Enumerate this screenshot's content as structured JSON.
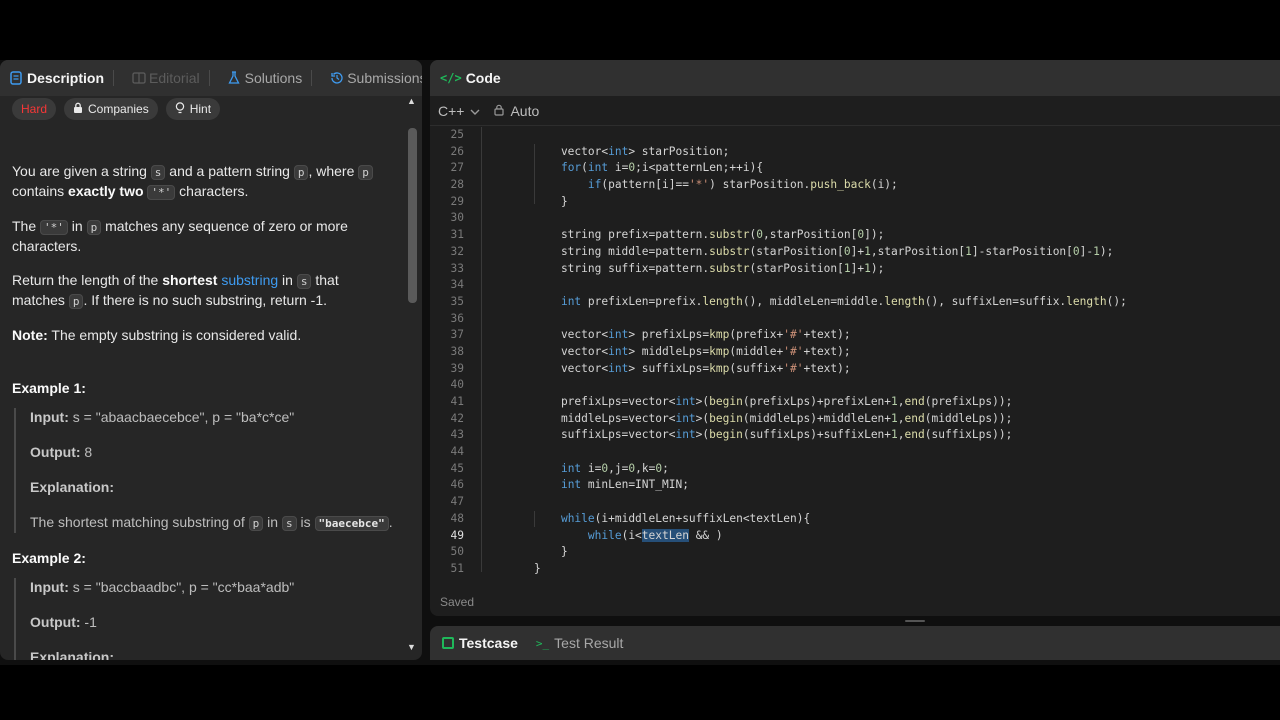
{
  "left_tabs": {
    "description": "Description",
    "editorial": "Editorial",
    "solutions": "Solutions",
    "submissions": "Submissions"
  },
  "chips": {
    "difficulty": "Hard",
    "companies": "Companies",
    "hint": "Hint"
  },
  "problem": {
    "p1_a": "You are given a string ",
    "p1_s": "s",
    "p1_b": " and a pattern string ",
    "p1_p": "p",
    "p1_c": ", where ",
    "p1_p2": "p",
    "p1_d": " contains ",
    "p1_bold": "exactly two",
    "p1_star": "'*'",
    "p1_e": " characters.",
    "p2_a": "The ",
    "p2_star": "'*'",
    "p2_b": " in ",
    "p2_p": "p",
    "p2_c": " matches any sequence of zero or more characters.",
    "p3_a": "Return the length of the ",
    "p3_bold": "shortest",
    "p3_link": "substring",
    "p3_b": " in ",
    "p3_s": "s",
    "p3_c": " that matches ",
    "p3_p": "p",
    "p3_d": ". If there is no such substring, return -1.",
    "note_label": "Note:",
    "note_text": " The empty substring is considered valid."
  },
  "examples": [
    {
      "title": "Example 1:",
      "input_label": "Input:",
      "input_value": " s = \"abaacbaecebce\", p = \"ba*c*ce\"",
      "output_label": "Output:",
      "output_value": " 8",
      "explanation_label": "Explanation:",
      "explanation_a": "The shortest matching substring of ",
      "explanation_p": "p",
      "explanation_b": " in ",
      "explanation_s": "s",
      "explanation_c": " is ",
      "explanation_code": "\"baecebce\"",
      "explanation_d": "."
    },
    {
      "title": "Example 2:",
      "input_label": "Input:",
      "input_value": " s = \"baccbaadbc\", p = \"cc*baa*adb\"",
      "output_label": "Output:",
      "output_value": " -1",
      "explanation_label": "Explanation:"
    }
  ],
  "code_panel": {
    "title": "Code",
    "language": "C++",
    "mode": "Auto",
    "status": "Saved"
  },
  "code_lines": [
    {
      "n": "25",
      "html": ""
    },
    {
      "n": "26",
      "html": "    vector&lt;<span class=\"kw\">int</span>&gt; starPosition;"
    },
    {
      "n": "27",
      "html": "    <span class=\"kw\">for</span>(<span class=\"kw\">int</span> i=<span class=\"nu\">0</span>;i&lt;patternLen;++i){"
    },
    {
      "n": "28",
      "html": "        <span class=\"kw\">if</span>(pattern[i]==<span class=\"st\">'*'</span>) starPosition.<span class=\"fn\">push_back</span>(i);"
    },
    {
      "n": "29",
      "html": "    }"
    },
    {
      "n": "30",
      "html": ""
    },
    {
      "n": "31",
      "html": "    string prefix=pattern.<span class=\"fn\">substr</span>(<span class=\"nu\">0</span>,starPosition[<span class=\"nu\">0</span>]);"
    },
    {
      "n": "32",
      "html": "    string middle=pattern.<span class=\"fn\">substr</span>(starPosition[<span class=\"nu\">0</span>]+<span class=\"nu\">1</span>,starPosition[<span class=\"nu\">1</span>]-starPosition[<span class=\"nu\">0</span>]-<span class=\"nu\">1</span>);"
    },
    {
      "n": "33",
      "html": "    string suffix=pattern.<span class=\"fn\">substr</span>(starPosition[<span class=\"nu\">1</span>]+<span class=\"nu\">1</span>);"
    },
    {
      "n": "34",
      "html": ""
    },
    {
      "n": "35",
      "html": "    <span class=\"kw\">int</span> prefixLen=prefix.<span class=\"fn\">length</span>(), middleLen=middle.<span class=\"fn\">length</span>(), suffixLen=suffix.<span class=\"fn\">length</span>();"
    },
    {
      "n": "36",
      "html": ""
    },
    {
      "n": "37",
      "html": "    vector&lt;<span class=\"kw\">int</span>&gt; prefixLps=<span class=\"fn\">kmp</span>(prefix+<span class=\"st\">'#'</span>+text);"
    },
    {
      "n": "38",
      "html": "    vector&lt;<span class=\"kw\">int</span>&gt; middleLps=<span class=\"fn\">kmp</span>(middle+<span class=\"st\">'#'</span>+text);"
    },
    {
      "n": "39",
      "html": "    vector&lt;<span class=\"kw\">int</span>&gt; suffixLps=<span class=\"fn\">kmp</span>(suffix+<span class=\"st\">'#'</span>+text);"
    },
    {
      "n": "40",
      "html": ""
    },
    {
      "n": "41",
      "html": "    prefixLps=vector&lt;<span class=\"kw\">int</span>&gt;(<span class=\"fn\">begin</span>(prefixLps)+prefixLen+<span class=\"nu\">1</span>,<span class=\"fn\">end</span>(prefixLps));"
    },
    {
      "n": "42",
      "html": "    middleLps=vector&lt;<span class=\"kw\">int</span>&gt;(<span class=\"fn\">begin</span>(middleLps)+middleLen+<span class=\"nu\">1</span>,<span class=\"fn\">end</span>(middleLps));"
    },
    {
      "n": "43",
      "html": "    suffixLps=vector&lt;<span class=\"kw\">int</span>&gt;(<span class=\"fn\">begin</span>(suffixLps)+suffixLen+<span class=\"nu\">1</span>,<span class=\"fn\">end</span>(suffixLps));"
    },
    {
      "n": "44",
      "html": ""
    },
    {
      "n": "45",
      "html": "    <span class=\"kw\">int</span> i=<span class=\"nu\">0</span>,j=<span class=\"nu\">0</span>,k=<span class=\"nu\">0</span>;"
    },
    {
      "n": "46",
      "html": "    <span class=\"kw\">int</span> minLen=INT_MIN;"
    },
    {
      "n": "47",
      "html": ""
    },
    {
      "n": "48",
      "html": "    <span class=\"kw\">while</span>(i+middleLen+suffixLen&lt;textLen){"
    },
    {
      "n": "49",
      "html": "        <span class=\"kw\">while</span>(i&lt;<span class=\"hl\">textLen</span> &amp;&amp; )"
    },
    {
      "n": "50",
      "html": "    }"
    },
    {
      "n": "51",
      "html": "}"
    }
  ],
  "bottom_tabs": {
    "testcase": "Testcase",
    "test_result": "Test Result"
  },
  "colors": {
    "hard": "#f63737",
    "accent_green": "#1fb85a",
    "link": "#3e9bf0"
  }
}
